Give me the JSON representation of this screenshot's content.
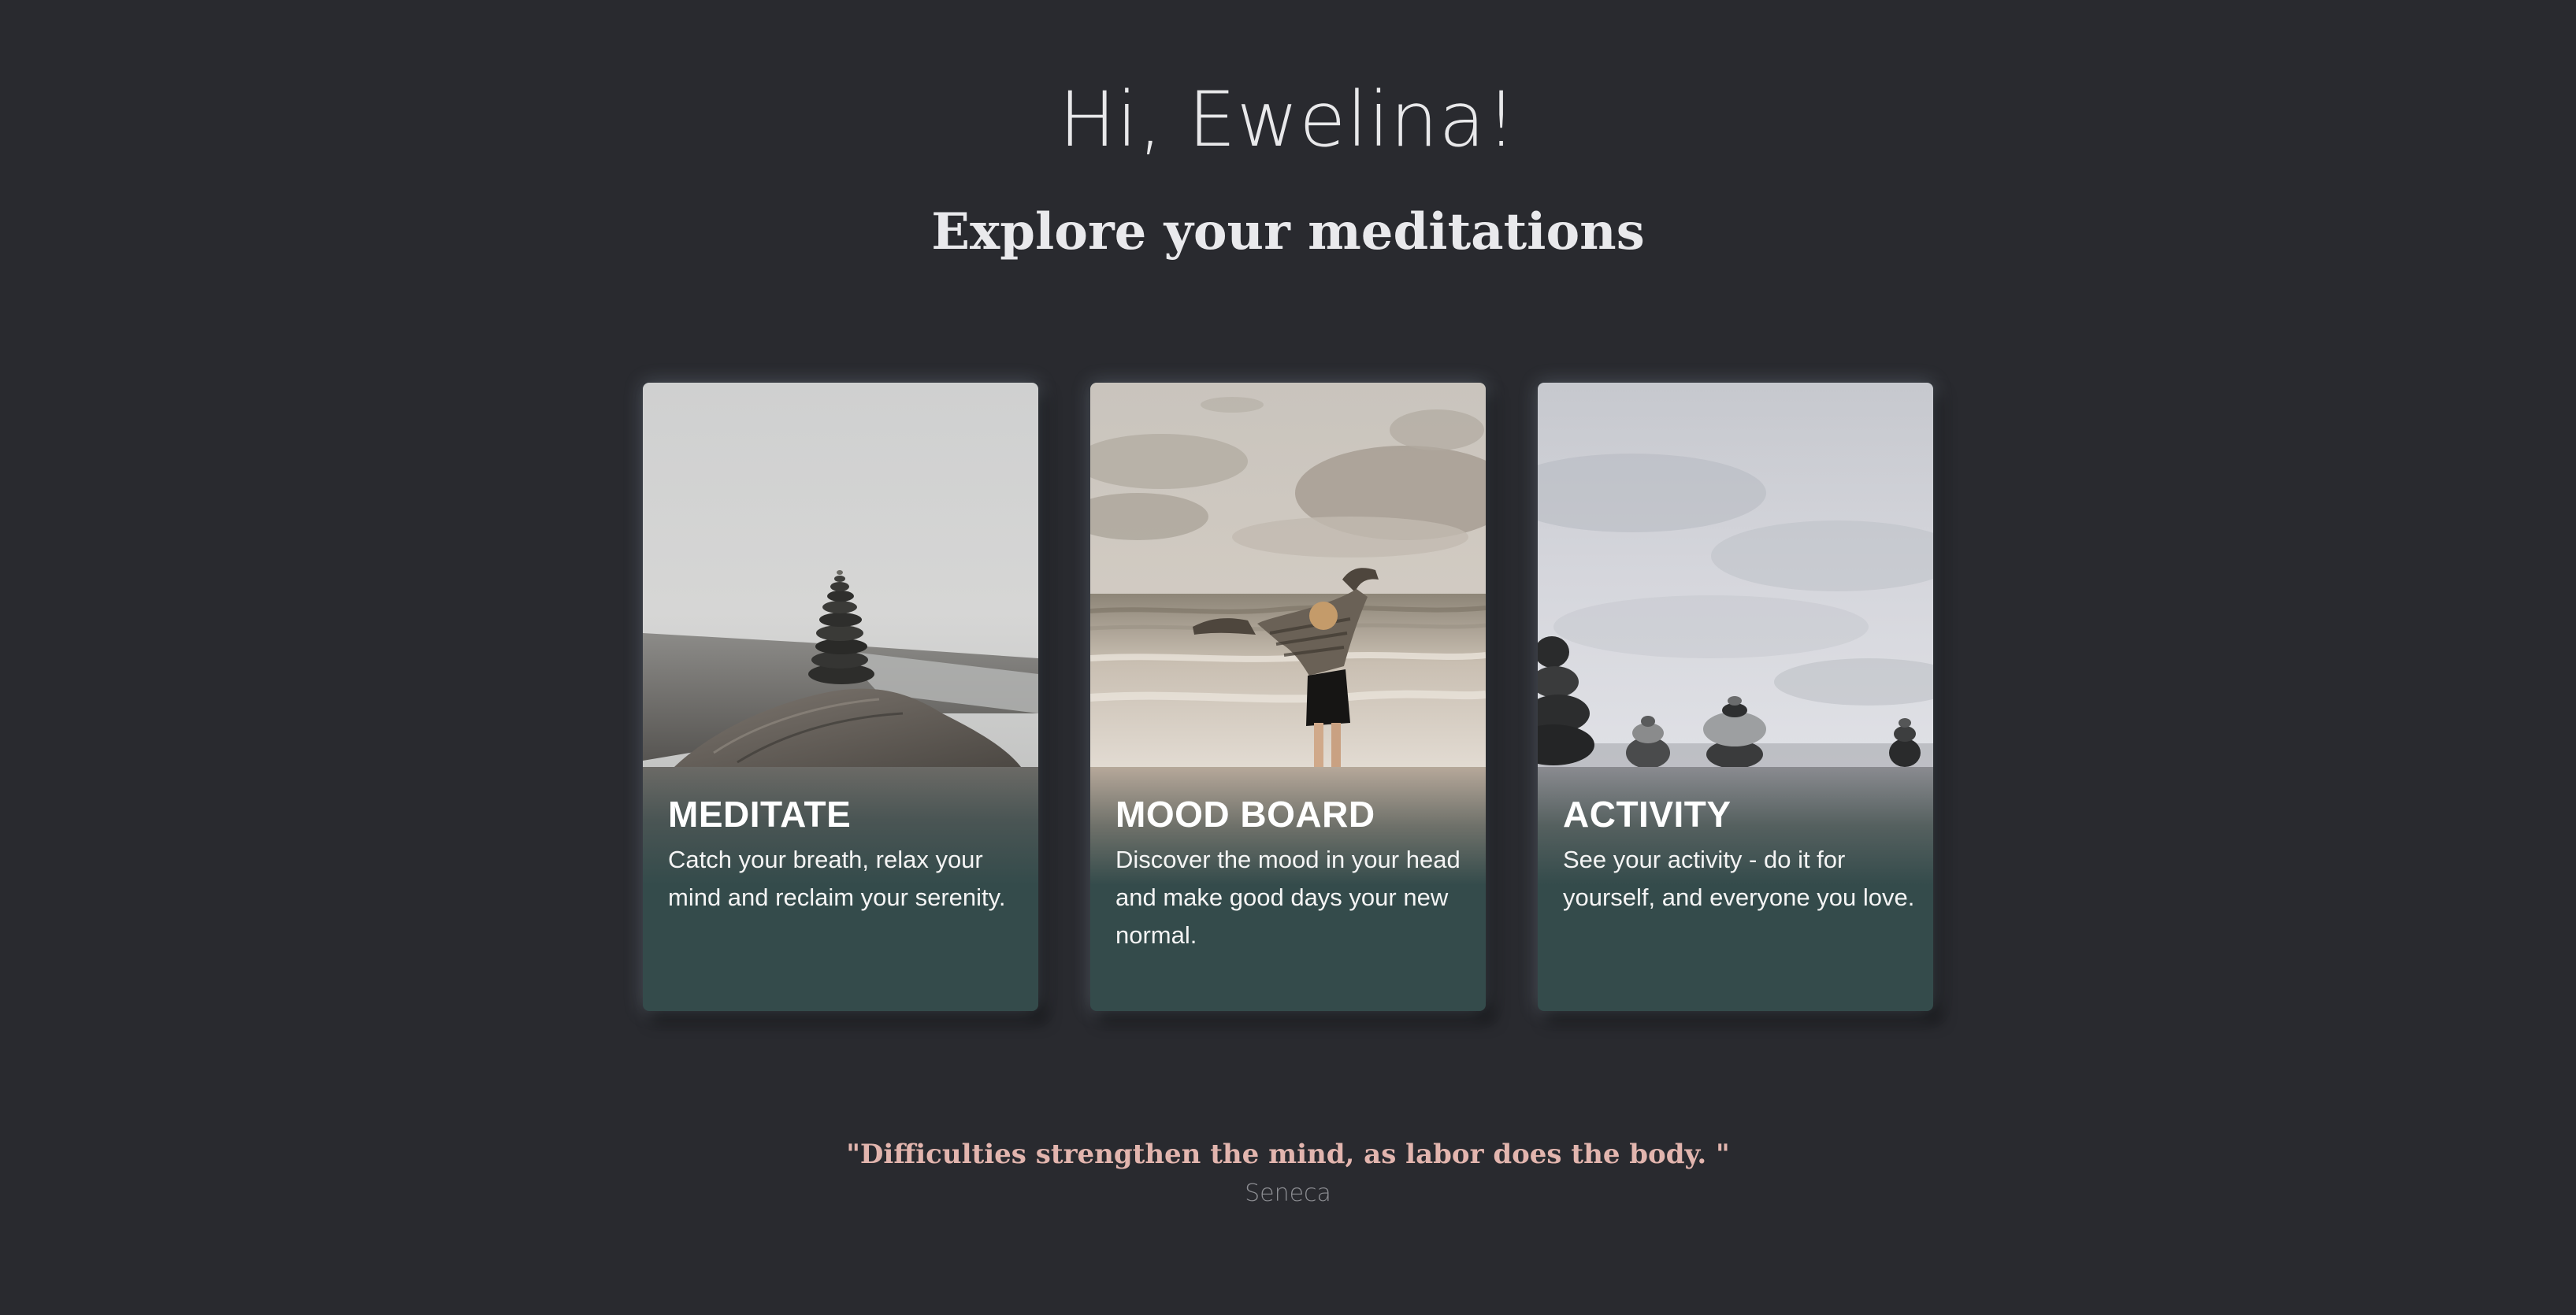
{
  "header": {
    "greeting": "Hi, Ewelina!",
    "subtitle": "Explore your meditations"
  },
  "cards": [
    {
      "title": "MEDITATE",
      "description": "Catch your breath, relax your mind and reclaim your serenity.",
      "image": "stacked-stones-foggy-beach"
    },
    {
      "title": "MOOD BOARD",
      "description": "Discover the mood in your head and make good days your new normal.",
      "image": "woman-arms-raised-sea"
    },
    {
      "title": "ACTIVITY",
      "description": "See your activity - do it for yourself, and everyone you love.",
      "image": "stone-cairns-misty-sea"
    }
  ],
  "quote": {
    "text": "\"Difficulties strengthen the mind, as labor does the body. \"",
    "author": "Seneca"
  },
  "colors": {
    "background": "#292a2f",
    "card_panel": "#344b4b",
    "quote_text": "#e2b5ae",
    "author_text": "#8d8e93"
  }
}
